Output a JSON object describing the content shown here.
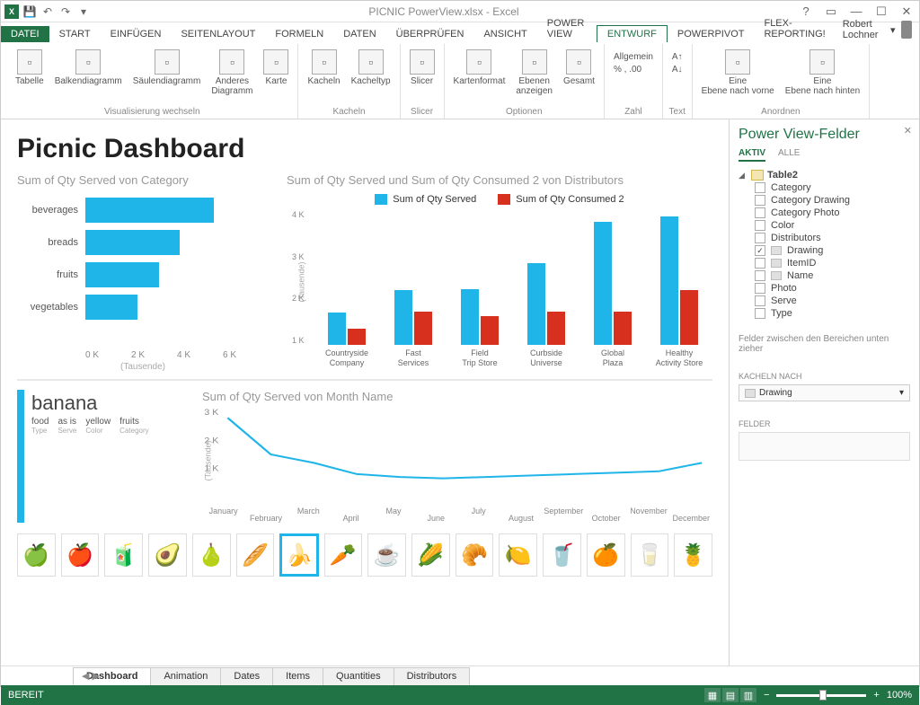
{
  "titlebar": {
    "title": "PICNIC PowerView.xlsx - Excel"
  },
  "menu": {
    "file": "DATEI",
    "tabs": [
      "START",
      "EINFÜGEN",
      "SEITENLAYOUT",
      "FORMELN",
      "DATEN",
      "ÜBERPRÜFEN",
      "ANSICHT",
      "POWER VIEW",
      "ENTWURF",
      "POWERPIVOT",
      "FLEX-Reporting!"
    ],
    "active": "ENTWURF",
    "user": "Robert Lochner"
  },
  "ribbon": {
    "groups": [
      {
        "title": "Visualisierung wechseln",
        "items": [
          {
            "l": "Tabelle"
          },
          {
            "l": "Balkendiagramm"
          },
          {
            "l": "Säulendiagramm"
          },
          {
            "l": "Anderes Diagramm"
          },
          {
            "l": "Karte"
          }
        ]
      },
      {
        "title": "Kacheln",
        "items": [
          {
            "l": "Kacheln"
          },
          {
            "l": "Kacheltyp"
          }
        ]
      },
      {
        "title": "Slicer",
        "items": [
          {
            "l": "Slicer"
          }
        ]
      },
      {
        "title": "Optionen",
        "items": [
          {
            "l": "Kartenformat"
          },
          {
            "l": "Ebenen anzeigen"
          },
          {
            "l": "Gesamt"
          }
        ]
      },
      {
        "title": "Zahl",
        "small": [
          "Allgemein",
          "% , .00"
        ]
      },
      {
        "title": "Text",
        "small": [
          "A↑",
          "A↓"
        ]
      },
      {
        "title": "Anordnen",
        "items": [
          {
            "l": "Eine Ebene nach vorne"
          },
          {
            "l": "Eine Ebene nach hinten"
          }
        ]
      }
    ]
  },
  "dashboard": {
    "title": "Picnic Dashboard",
    "chart1_title": "Sum of Qty Served von Category",
    "chart2_title": "Sum of Qty Served und Sum of Qty Consumed 2 von Distributors",
    "legend": {
      "a": "Sum of Qty Served",
      "b": "Sum of Qty Consumed 2"
    },
    "axis_sub": "(Tausende)",
    "card": {
      "title": "banana",
      "meta": [
        {
          "v": "food",
          "k": "Type"
        },
        {
          "v": "as is",
          "k": "Serve"
        },
        {
          "v": "yellow",
          "k": "Color"
        },
        {
          "v": "fruits",
          "k": "Category"
        }
      ]
    },
    "chart3_title": "Sum of Qty Served von Month Name"
  },
  "chart_data": [
    {
      "type": "bar",
      "orientation": "horizontal",
      "title": "Sum of Qty Served von Category",
      "categories": [
        "beverages",
        "breads",
        "fruits",
        "vegetables"
      ],
      "values": [
        4200,
        3100,
        2400,
        1700
      ],
      "xticks": [
        "0 K",
        "2 K",
        "4 K",
        "6 K"
      ],
      "xlabel": "(Tausende)"
    },
    {
      "type": "bar",
      "title": "Sum of Qty Served und Sum of Qty Consumed 2 von Distributors",
      "categories": [
        "Countryside Company",
        "Fast Services",
        "Field Trip Store",
        "Curbside Universe",
        "Global Plaza",
        "Healthy Activity Store"
      ],
      "series": [
        {
          "name": "Sum of Qty Served",
          "values": [
            1000,
            1700,
            1750,
            2550,
            3850,
            4000
          ],
          "color": "#1fb5e8"
        },
        {
          "name": "Sum of Qty Consumed 2",
          "values": [
            500,
            1050,
            900,
            1050,
            1050,
            1700
          ],
          "color": "#d7301f"
        }
      ],
      "yticks": [
        "1 K",
        "2 K",
        "3 K",
        "4 K"
      ],
      "ylabel": "(Tausende)"
    },
    {
      "type": "line",
      "title": "Sum of Qty Served von Month Name",
      "x": [
        "January",
        "February",
        "March",
        "April",
        "May",
        "June",
        "July",
        "August",
        "September",
        "October",
        "November",
        "December"
      ],
      "values": [
        2800,
        1500,
        1200,
        800,
        700,
        650,
        700,
        750,
        800,
        850,
        900,
        1200
      ],
      "yticks": [
        "1 K",
        "2 K",
        "3 K"
      ],
      "ylabel": "(Tausende)"
    }
  ],
  "tiles": [
    "🍏",
    "🍎",
    "🧃",
    "🥑",
    "🍐",
    "🥖",
    "🍌",
    "🥕",
    "☕",
    "🌽",
    "🥐",
    "🍋",
    "🥤",
    "🍊",
    "🥛",
    "🍍"
  ],
  "tile_selected": 6,
  "pane": {
    "title": "Power View-Felder",
    "tabs": {
      "a": "AKTIV",
      "b": "ALLE"
    },
    "table": "Table2",
    "fields": [
      {
        "n": "Category",
        "c": false
      },
      {
        "n": "Category Drawing",
        "c": false
      },
      {
        "n": "Category Photo",
        "c": false
      },
      {
        "n": "Color",
        "c": false
      },
      {
        "n": "Distributors",
        "c": false
      },
      {
        "n": "Drawing",
        "c": true,
        "i": true
      },
      {
        "n": "ItemID",
        "c": false,
        "i": true
      },
      {
        "n": "Name",
        "c": false,
        "i": true
      },
      {
        "n": "Photo",
        "c": false
      },
      {
        "n": "Serve",
        "c": false
      },
      {
        "n": "Type",
        "c": false
      }
    ],
    "note": "Felder zwischen den Bereichen unten zieher",
    "sec1": "KACHELN NACH",
    "sec1_val": "Drawing",
    "sec2": "FELDER"
  },
  "sheets": {
    "tabs": [
      "Dashboard",
      "Animation",
      "Dates",
      "Items",
      "Quantities",
      "Distributors"
    ],
    "active": "Dashboard"
  },
  "statusbar": {
    "status": "BEREIT",
    "zoom": "100%"
  }
}
